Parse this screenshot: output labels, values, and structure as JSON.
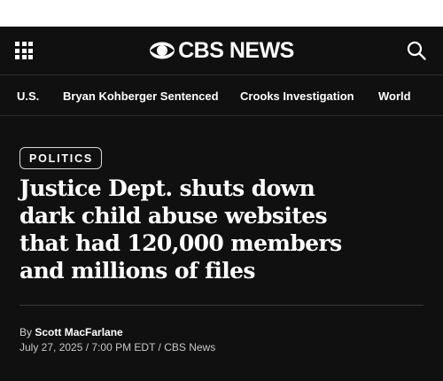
{
  "header": {
    "logo_text": "CBS NEWS",
    "menu_icon": "grid-menu-icon",
    "search_icon": "search-icon"
  },
  "nav": {
    "items": [
      {
        "label": "U.S."
      },
      {
        "label": "Bryan Kohberger Sentenced"
      },
      {
        "label": "Crooks Investigation"
      },
      {
        "label": "World"
      }
    ]
  },
  "article": {
    "category": "POLITICS",
    "headline_lines": [
      "Justice Dept. shuts down",
      "dark child abuse websites",
      "that had 120,000 members",
      "and millions of files"
    ],
    "byline_prefix": "By",
    "author": "Scott MacFarlane",
    "dateline": "July 27, 2025 / 7:00 PM EDT / CBS News"
  },
  "colors": {
    "background": "#101010",
    "text": "#ffffff",
    "muted_text": "#c8c8c8",
    "divider": "#3a3a3a"
  }
}
